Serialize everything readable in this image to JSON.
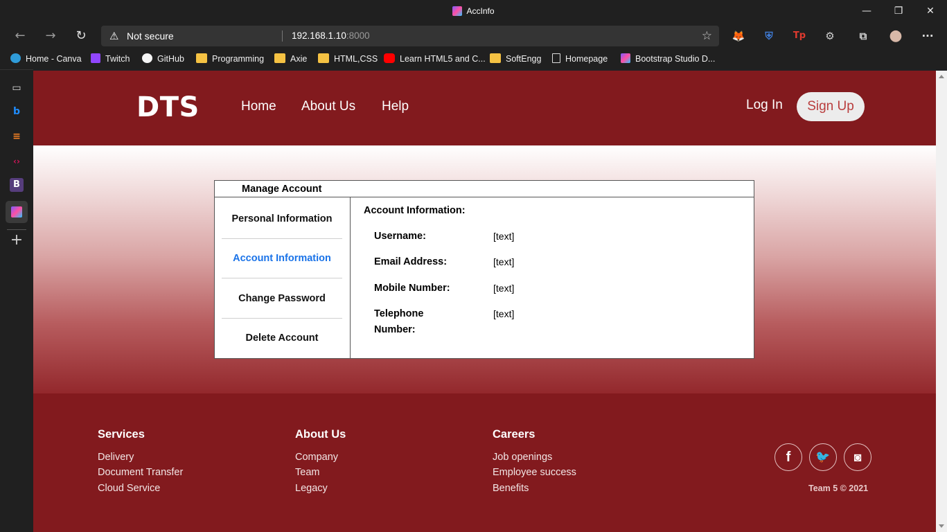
{
  "browser": {
    "tab_title": "AccInfo",
    "address": {
      "security_label": "Not secure",
      "host": "192.168.1.10",
      "port": ":8000"
    },
    "window_controls": {
      "minimize": "—",
      "restore": "❐",
      "close": "✕"
    },
    "nav": {
      "back": "←",
      "forward": "→",
      "reload": "↻"
    },
    "extensions": [
      {
        "icon": "metamask-fox-icon",
        "glyph": "🦊"
      },
      {
        "icon": "bitwarden-shield-icon",
        "glyph": "⛨"
      },
      {
        "icon": "tp-extension-icon",
        "glyph": "Tp"
      },
      {
        "icon": "puzzle-extensions-icon",
        "glyph": "⚙"
      },
      {
        "icon": "collections-icon",
        "glyph": "⧉"
      },
      {
        "icon": "profile-avatar-icon",
        "glyph": "●"
      },
      {
        "icon": "more-menu-icon",
        "glyph": "···"
      }
    ],
    "bookmarks": [
      {
        "label": "Home - Canva",
        "icon": "canva-icon"
      },
      {
        "label": "Twitch",
        "icon": "twitch-icon"
      },
      {
        "label": "GitHub",
        "icon": "github-icon"
      },
      {
        "label": "Programming",
        "icon": "folder-icon"
      },
      {
        "label": "Axie",
        "icon": "folder-icon"
      },
      {
        "label": "HTML,CSS",
        "icon": "folder-icon"
      },
      {
        "label": "Learn HTML5 and C...",
        "icon": "youtube-icon"
      },
      {
        "label": "SoftEngg",
        "icon": "folder-icon"
      },
      {
        "label": "Homepage",
        "icon": "page-icon"
      },
      {
        "label": "Bootstrap Studio D...",
        "icon": "bootstrap-studio-icon"
      }
    ],
    "sidebar_icons": [
      "tabs-icon",
      "bing-icon",
      "stackoverflow-icon",
      "code-icon",
      "bootstrap-icon",
      "bootstrap-studio-icon",
      "add-icon"
    ]
  },
  "site": {
    "logo": "DTS",
    "nav": [
      "Home",
      "About Us",
      "Help"
    ],
    "login": "Log In",
    "signup": "Sign Up",
    "colors": {
      "brand": "#821a1e",
      "active_link": "#1a73e8",
      "signup_text": "#b93d3d"
    }
  },
  "manage": {
    "title": "Manage Account",
    "menu": [
      "Personal Information",
      "Account Information",
      "Change Password",
      "Delete Account"
    ],
    "active_index": 1,
    "section_title": "Account Information:",
    "fields": [
      {
        "label": "Username:",
        "value": "[text]"
      },
      {
        "label": "Email Address:",
        "value": "[text]"
      },
      {
        "label": "Mobile Number:",
        "value": "[text]"
      },
      {
        "label": "Telephone Number:",
        "value": "[text]"
      }
    ]
  },
  "footer": {
    "columns": [
      {
        "heading": "Services",
        "links": [
          "Delivery",
          "Document Transfer",
          "Cloud Service"
        ]
      },
      {
        "heading": "About Us",
        "links": [
          "Company",
          "Team",
          "Legacy"
        ]
      },
      {
        "heading": "Careers",
        "links": [
          "Job openings",
          "Employee success",
          "Benefits"
        ]
      }
    ],
    "social": [
      {
        "icon": "facebook-icon",
        "glyph": "f"
      },
      {
        "icon": "twitter-icon",
        "glyph": "🐦"
      },
      {
        "icon": "instagram-icon",
        "glyph": "◙"
      }
    ],
    "copyright": "Team 5 © 2021"
  }
}
